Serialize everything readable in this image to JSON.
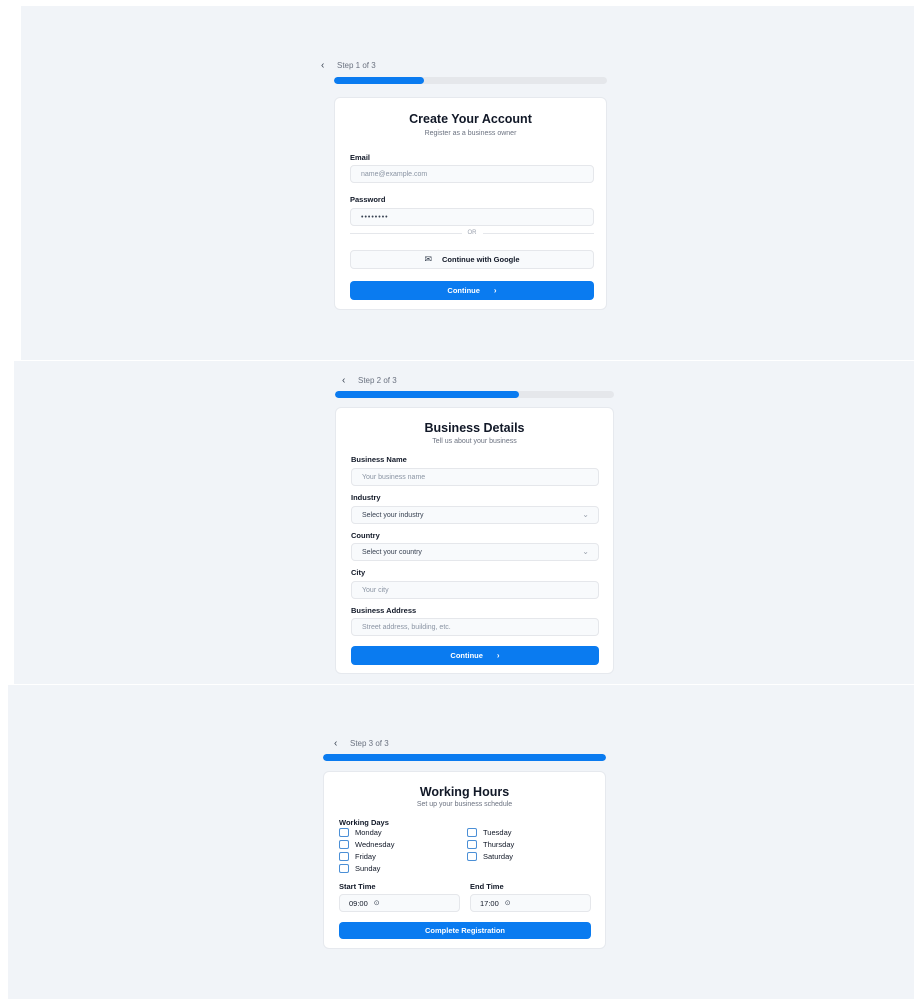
{
  "step1": {
    "step_label": "Step 1 of 3",
    "progress": 0.33,
    "title": "Create Your Account",
    "subtitle": "Register as a business owner",
    "email_label": "Email",
    "email_placeholder": "name@example.com",
    "password_label": "Password",
    "password_value": "••••••••",
    "divider_text": "OR",
    "google_label": "Continue with Google",
    "continue_label": "Continue"
  },
  "step2": {
    "step_label": "Step 2 of 3",
    "progress": 0.66,
    "title": "Business Details",
    "subtitle": "Tell us about your business",
    "business_name_label": "Business Name",
    "business_name_placeholder": "Your business name",
    "industry_label": "Industry",
    "industry_value": "Select your industry",
    "country_label": "Country",
    "country_value": "Select your country",
    "city_label": "City",
    "city_placeholder": "Your city",
    "address_label": "Business Address",
    "address_placeholder": "Street address, building, etc.",
    "continue_label": "Continue"
  },
  "step3": {
    "step_label": "Step 3 of 3",
    "progress": 1.0,
    "title": "Working Hours",
    "subtitle": "Set up your business schedule",
    "days_label": "Working Days",
    "days": [
      "Monday",
      "Tuesday",
      "Wednesday",
      "Thursday",
      "Friday",
      "Saturday",
      "Sunday"
    ],
    "start_label": "Start Time",
    "start_value": "09:00",
    "end_label": "End Time",
    "end_value": "17:00",
    "submit_label": "Complete Registration"
  },
  "icons": {
    "back": "chevron-left-icon",
    "next": "chevron-right-icon",
    "dropdown": "chevron-down-icon",
    "mail": "mail-icon",
    "clock": "clock-icon"
  },
  "colors": {
    "accent": "#0a7bf0",
    "background": "#f1f4f8",
    "card": "#ffffff"
  }
}
